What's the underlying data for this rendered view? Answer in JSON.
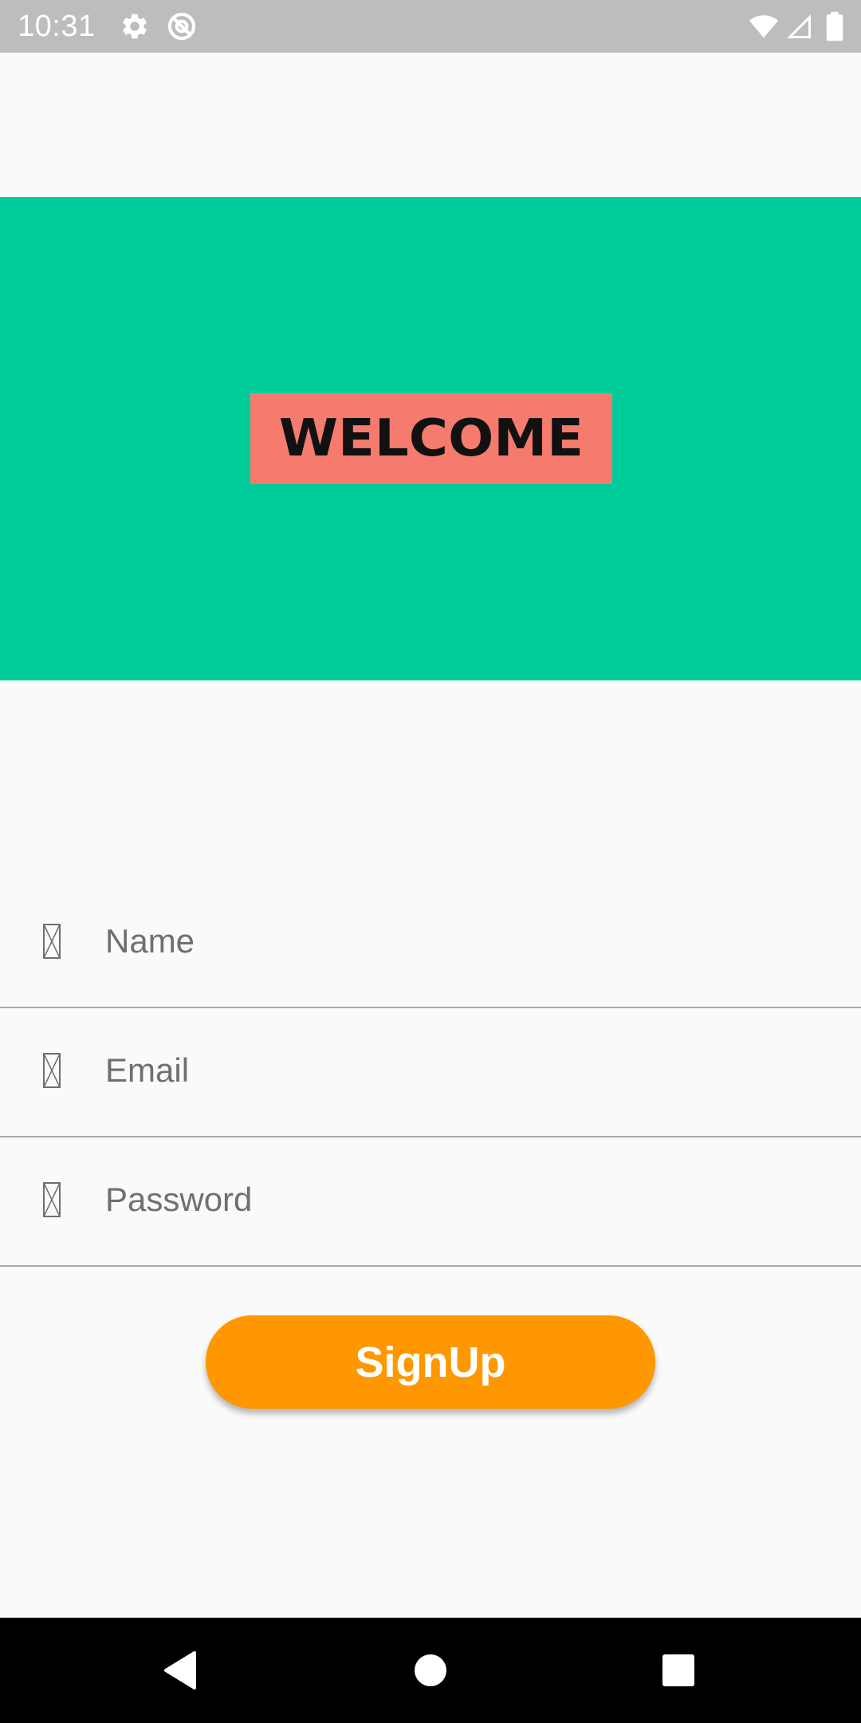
{
  "status_bar": {
    "time": "10:31",
    "icons": [
      "settings-icon",
      "no-data-icon",
      "wifi-icon",
      "signal-icon",
      "battery-icon"
    ],
    "background": "#bdbdbd"
  },
  "banner": {
    "welcome_text": "WELCOME",
    "background": "#00cc99",
    "label_background": "#f47b6e"
  },
  "form": {
    "name": {
      "placeholder": "Name",
      "value": "",
      "icon": "missing-glyph-icon"
    },
    "email": {
      "placeholder": "Email",
      "value": "",
      "icon": "missing-glyph-icon"
    },
    "password": {
      "placeholder": "Password",
      "value": "",
      "icon": "missing-glyph-icon"
    },
    "signup_label": "SignUp",
    "signup_color": "#ff9800"
  },
  "nav_bar": {
    "icons": [
      "back-icon",
      "home-icon",
      "recents-icon"
    ]
  }
}
